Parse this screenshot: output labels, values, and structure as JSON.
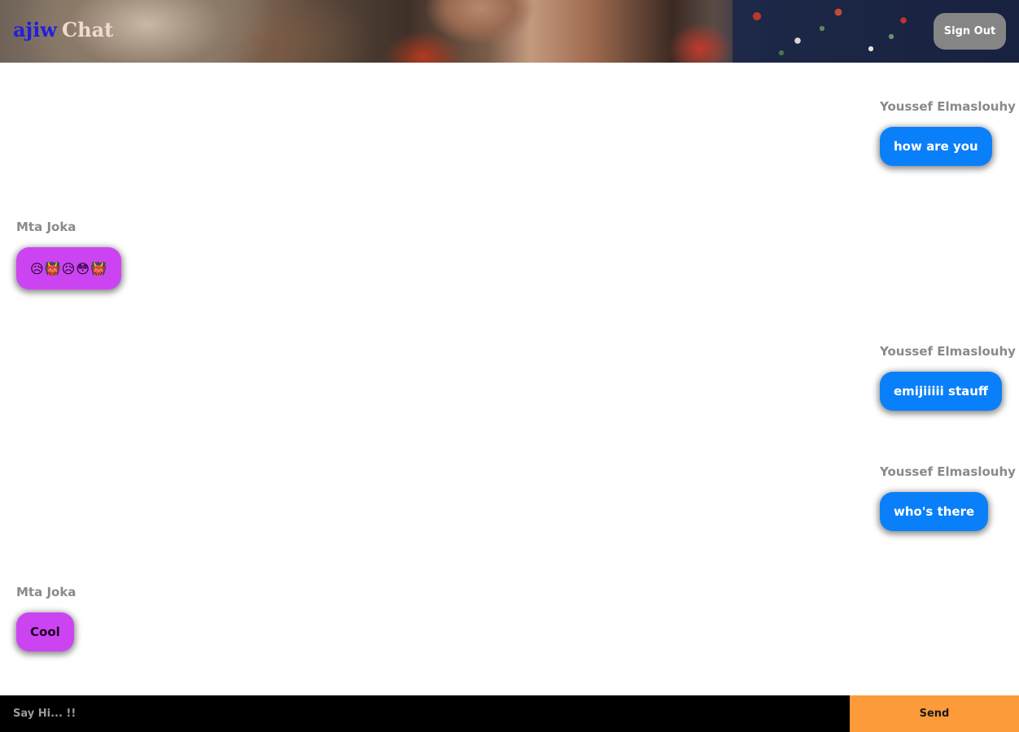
{
  "header": {
    "logo_brand": "ajiw",
    "logo_chat": "Chat",
    "sign_out_label": "Sign Out"
  },
  "messages": [
    {
      "sender": "Youssef Elmaslouhy",
      "text": "how are you",
      "side": "right"
    },
    {
      "sender": "Mta Joka",
      "text": "😥👹😥😳👹",
      "side": "left"
    },
    {
      "sender": "Youssef Elmaslouhy",
      "text": "emijiiiii stauff",
      "side": "right"
    },
    {
      "sender": "Youssef Elmaslouhy",
      "text": "who's there",
      "side": "right"
    },
    {
      "sender": "Mta Joka",
      "text": "Cool",
      "side": "left"
    }
  ],
  "composer": {
    "placeholder": "Say Hi... !!",
    "send_label": "Send"
  },
  "colors": {
    "mine_bubble": "#0a7ffa",
    "theirs_bubble": "#cc44f2",
    "send_button": "#fd9a3a",
    "sign_out_button": "#858585"
  }
}
